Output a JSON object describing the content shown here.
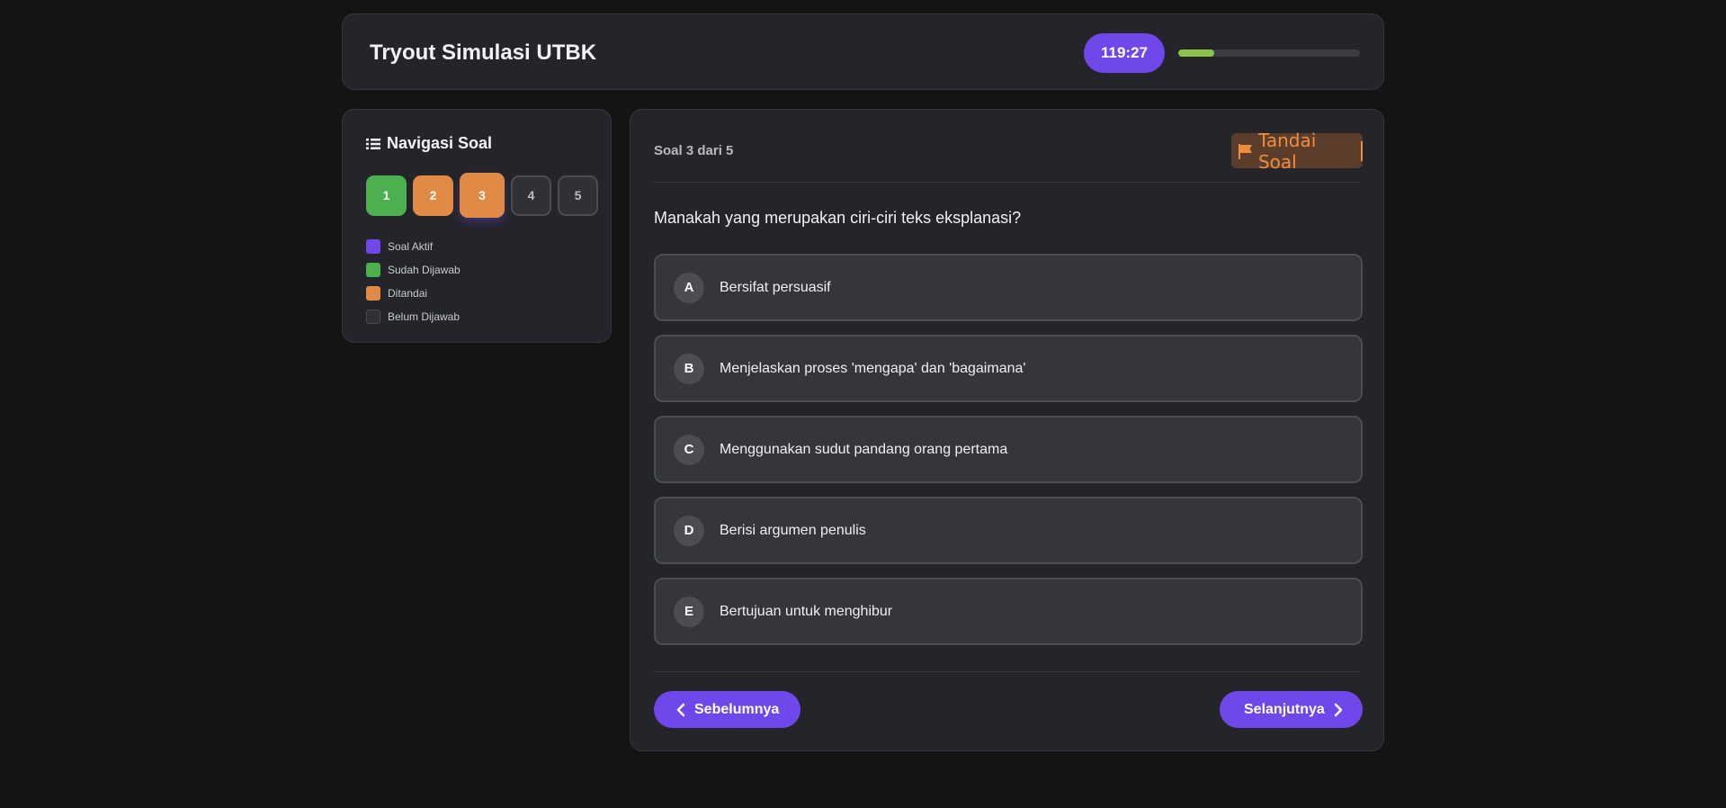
{
  "header": {
    "title": "Tryout Simulasi UTBK",
    "timer": "119:27",
    "progress_fraction": 0.2
  },
  "sidebar": {
    "title": "Navigasi Soal",
    "title_icon": "list-icon",
    "questions": [
      {
        "label": "1",
        "status": "answered"
      },
      {
        "label": "2",
        "status": "flagged"
      },
      {
        "label": "3",
        "status": "active-flagged"
      },
      {
        "label": "4",
        "status": "unanswered"
      },
      {
        "label": "5",
        "status": "unanswered"
      }
    ],
    "legend": [
      {
        "label": "Soal Aktif",
        "color": "#7047eb"
      },
      {
        "label": "Sudah Dijawab",
        "color": "#4caf50"
      },
      {
        "label": "Ditandai",
        "color": "#e08a45"
      },
      {
        "label": "Belum Dijawab",
        "color": "#2f3136"
      }
    ]
  },
  "main": {
    "counter": "Soal 3 dari 5",
    "flag_label": "Tandai Soal",
    "flag_icon": "flag-icon",
    "question": "Manakah yang merupakan ciri-ciri teks eksplanasi?",
    "options": [
      {
        "letter": "A",
        "text": "Bersifat persuasif"
      },
      {
        "letter": "B",
        "text": "Menjelaskan proses 'mengapa' dan 'bagaimana'"
      },
      {
        "letter": "C",
        "text": "Menggunakan sudut pandang orang pertama"
      },
      {
        "letter": "D",
        "text": "Berisi argumen penulis"
      },
      {
        "letter": "E",
        "text": "Bertujuan untuk menghibur"
      }
    ],
    "prev_label": "Sebelumnya",
    "next_label": "Selanjutnya"
  },
  "colors": {
    "accent": "#7047eb",
    "answered": "#4caf50",
    "flagged": "#e08a45",
    "progress": "#8bc34a"
  }
}
